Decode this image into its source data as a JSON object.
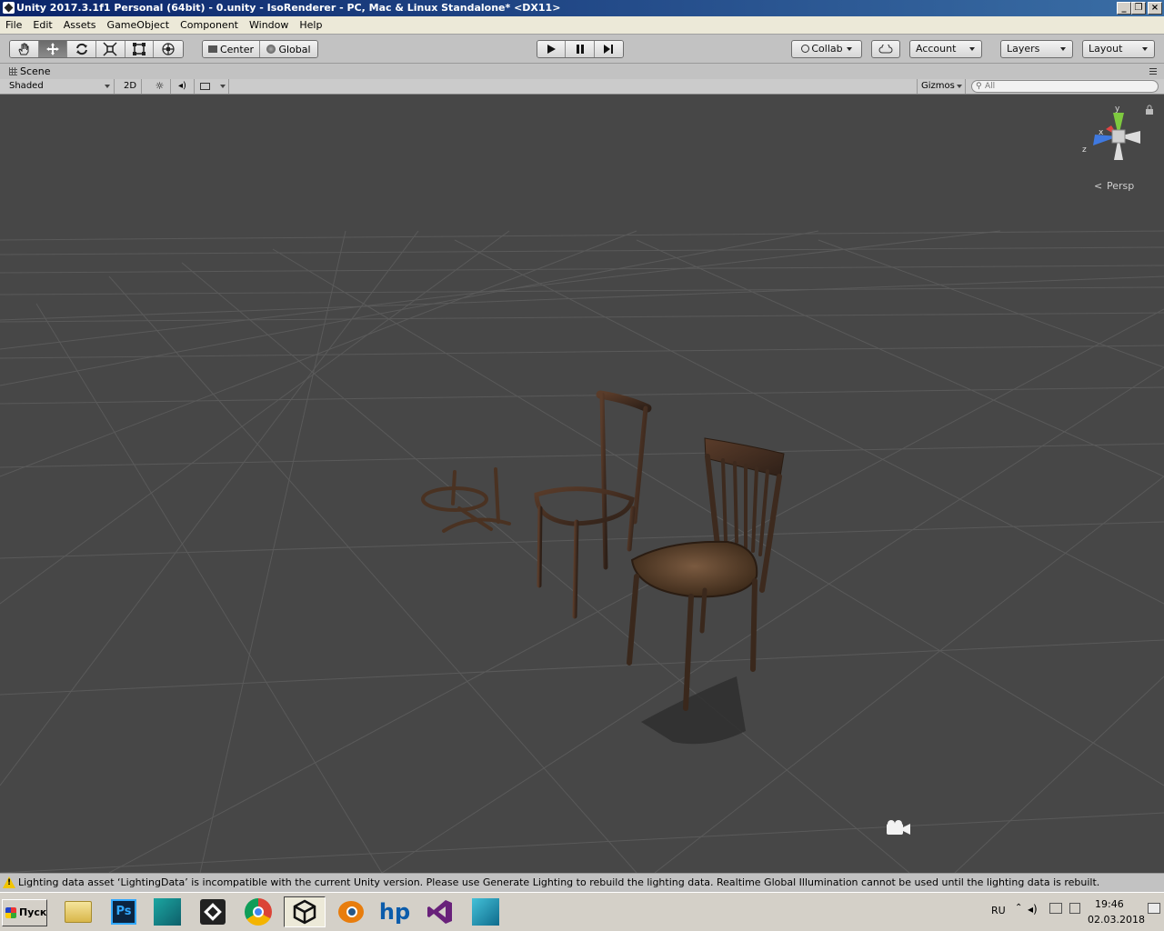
{
  "window": {
    "title": "Unity 2017.3.1f1 Personal (64bit) - 0.unity - IsoRenderer - PC, Mac & Linux Standalone* <DX11>",
    "minimize_label": "_",
    "restore_label": "❐",
    "close_label": "×"
  },
  "menu": [
    "File",
    "Edit",
    "Assets",
    "GameObject",
    "Component",
    "Window",
    "Help"
  ],
  "toolbar": {
    "tools": [
      "hand-icon",
      "move-icon",
      "rotate-icon",
      "scale-icon",
      "rect-icon",
      "transform-icon"
    ],
    "active_tool": "move-icon",
    "pivot_label": "Center",
    "space_label": "Global",
    "collab_label": "Collab",
    "account_label": "Account",
    "layers_label": "Layers",
    "layout_label": "Layout"
  },
  "scene": {
    "tab_label": "Scene",
    "shading_mode": "Shaded",
    "mode_2d_label": "2D",
    "gizmos_label": "Gizmos",
    "search_placeholder": "All",
    "projection_label": "Persp",
    "axis_labels": {
      "x": "x",
      "y": "y",
      "z": "z"
    }
  },
  "status": {
    "message": "Lighting data asset ‘LightingData’ is incompatible with the current Unity version. Please use Generate Lighting to rebuild the lighting data.  Realtime Global Illumination cannot be used until the lighting data is rebuilt."
  },
  "taskbar": {
    "start_label": "Пуск",
    "apps": [
      "file-explorer-icon",
      "photoshop-icon",
      "3ds-max-icon",
      "unity-hub-icon",
      "chrome-icon",
      "unity-icon",
      "blender-icon",
      "hp-icon",
      "visual-studio-icon",
      "mudbox-icon"
    ],
    "active_app": "unity-icon",
    "language": "RU",
    "time": "19:46",
    "date": "02.03.2018"
  },
  "colors": {
    "viewport_bg": "#474747",
    "grid_line": "#5a5a5a",
    "title_bar": "#0a246a",
    "toolbar_bg": "#c2c2c2",
    "y_axis": "#7ec93f",
    "x_axis": "#e04343",
    "z_axis": "#3f79e0"
  }
}
